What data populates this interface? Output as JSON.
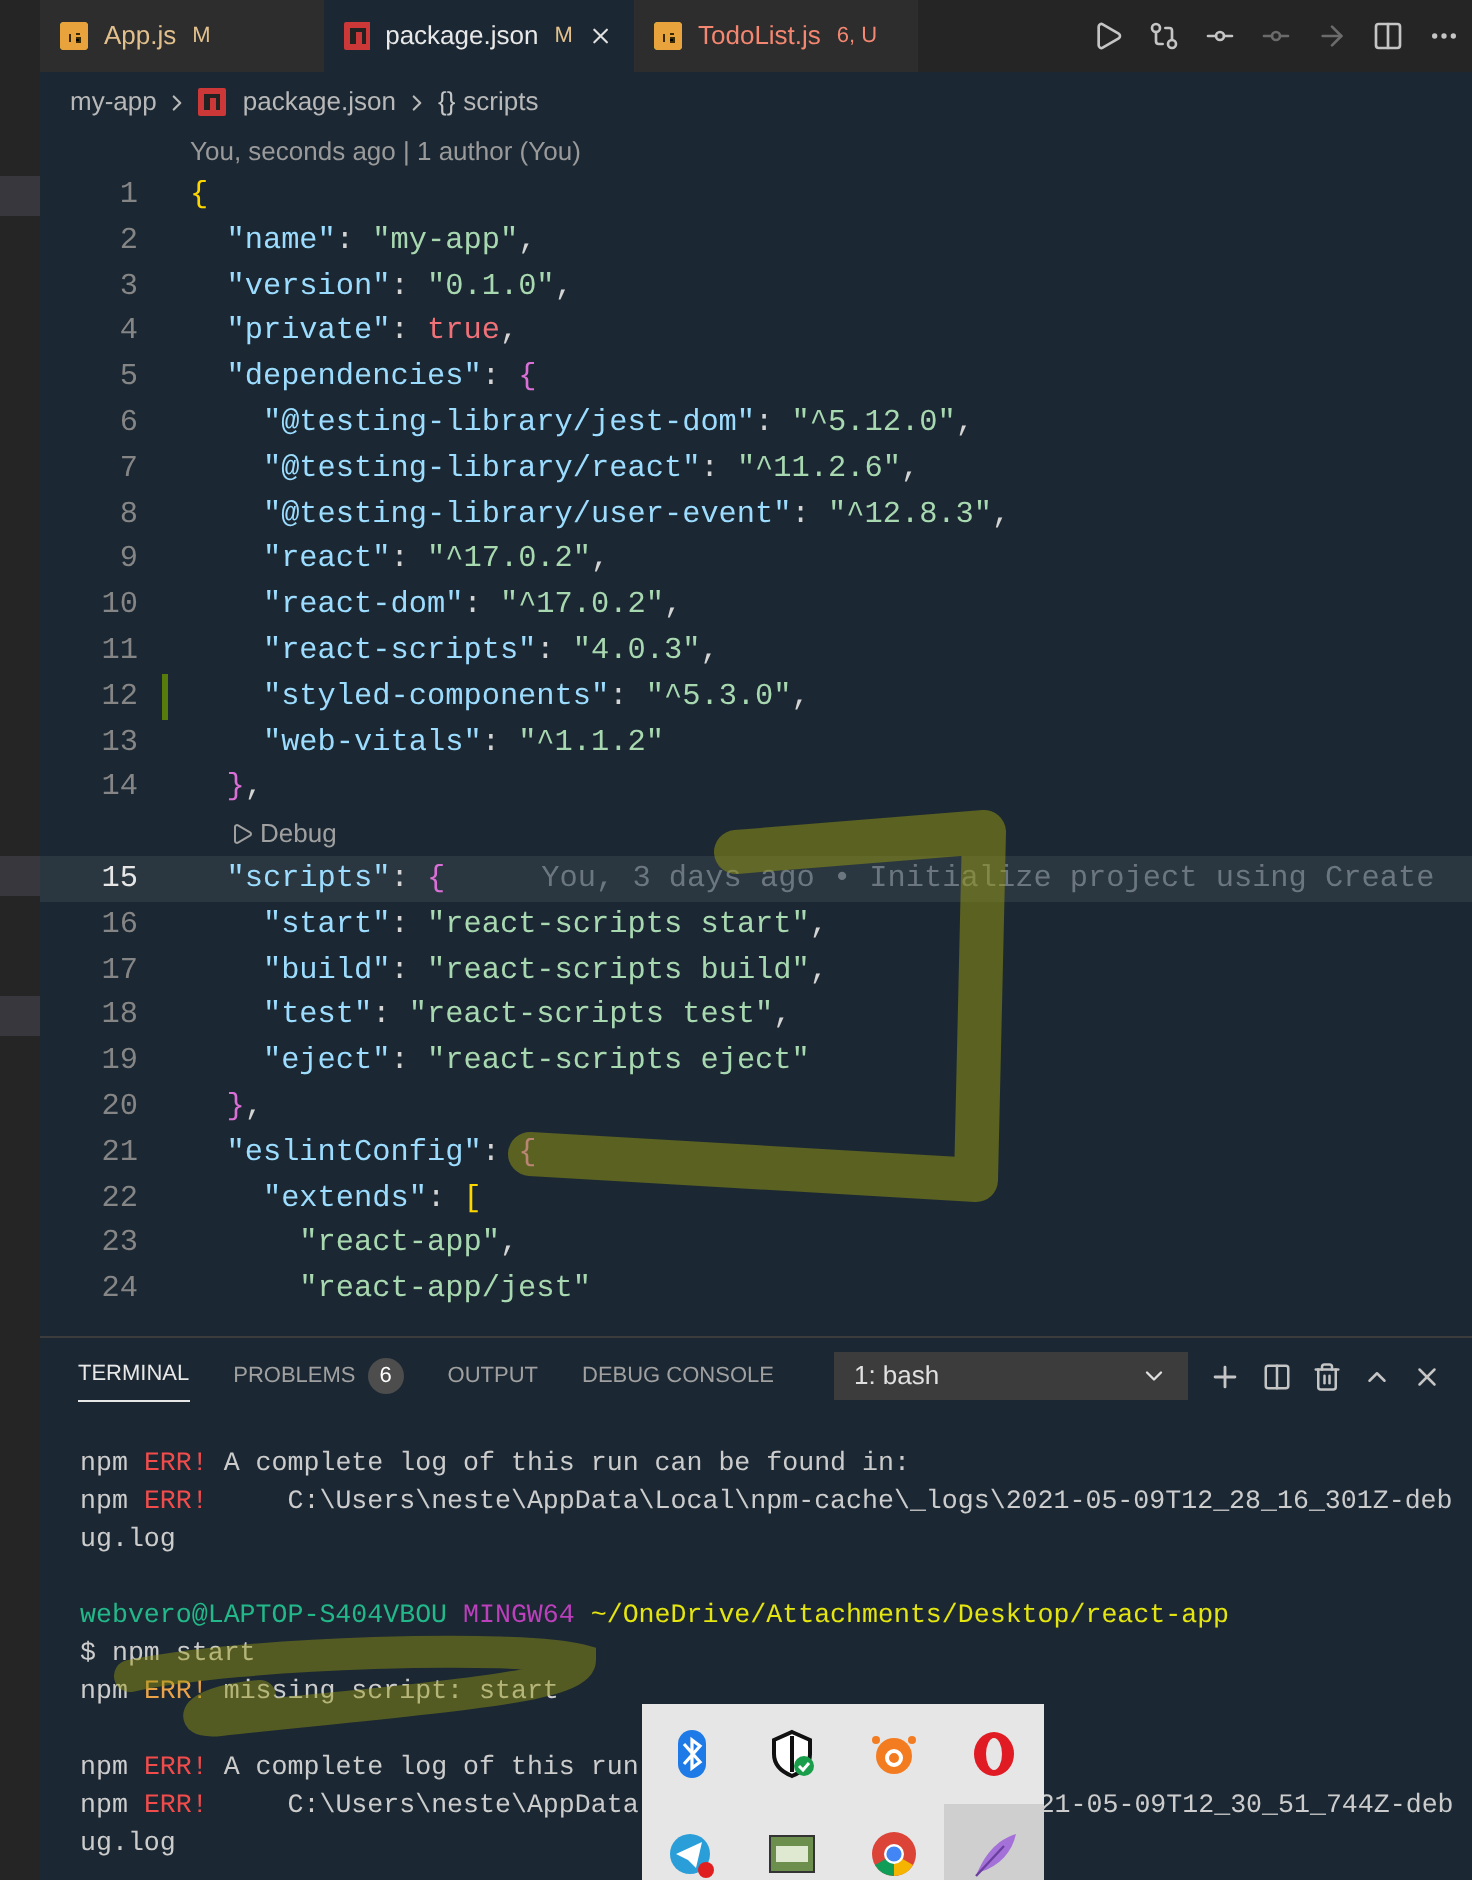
{
  "tabs": [
    {
      "label": "App.js",
      "status": "M",
      "selected": false,
      "kind": "js",
      "error": false
    },
    {
      "label": "package.json",
      "status": "M",
      "selected": true,
      "kind": "json",
      "error": false
    },
    {
      "label": "TodoList.js",
      "status": "6, U",
      "selected": false,
      "kind": "js",
      "error": true
    }
  ],
  "breadcrumbs": {
    "folder": "my-app",
    "file": "package.json",
    "symbol_icon": "{}",
    "symbol": "scripts"
  },
  "blame_header": "You, seconds ago | 1 author (You)",
  "code_lines": [
    {
      "number": "1",
      "tokens": [
        {
          "kind": "brace_outer",
          "text": "{"
        }
      ]
    },
    {
      "number": "2",
      "tokens": [
        {
          "kind": "key",
          "text": "  \"name\""
        },
        {
          "kind": "punct",
          "text": ": "
        },
        {
          "kind": "string",
          "text": "\"my-app\""
        },
        {
          "kind": "punct",
          "text": ","
        }
      ]
    },
    {
      "number": "3",
      "tokens": [
        {
          "kind": "key",
          "text": "  \"version\""
        },
        {
          "kind": "punct",
          "text": ": "
        },
        {
          "kind": "string",
          "text": "\"0.1.0\""
        },
        {
          "kind": "punct",
          "text": ","
        }
      ]
    },
    {
      "number": "4",
      "tokens": [
        {
          "kind": "key",
          "text": "  \"private\""
        },
        {
          "kind": "punct",
          "text": ": "
        },
        {
          "kind": "literal",
          "text": "true"
        },
        {
          "kind": "punct",
          "text": ","
        }
      ]
    },
    {
      "number": "5",
      "tokens": [
        {
          "kind": "key",
          "text": "  \"dependencies\""
        },
        {
          "kind": "punct",
          "text": ": "
        },
        {
          "kind": "brace_inner",
          "text": "{"
        }
      ]
    },
    {
      "number": "6",
      "tokens": [
        {
          "kind": "key",
          "text": "    \"@testing-library/jest-dom\""
        },
        {
          "kind": "punct",
          "text": ": "
        },
        {
          "kind": "string",
          "text": "\"^5.12.0\""
        },
        {
          "kind": "punct",
          "text": ","
        }
      ]
    },
    {
      "number": "7",
      "tokens": [
        {
          "kind": "key",
          "text": "    \"@testing-library/react\""
        },
        {
          "kind": "punct",
          "text": ": "
        },
        {
          "kind": "string",
          "text": "\"^11.2.6\""
        },
        {
          "kind": "punct",
          "text": ","
        }
      ]
    },
    {
      "number": "8",
      "tokens": [
        {
          "kind": "key",
          "text": "    \"@testing-library/user-event\""
        },
        {
          "kind": "punct",
          "text": ": "
        },
        {
          "kind": "string",
          "text": "\"^12.8.3\""
        },
        {
          "kind": "punct",
          "text": ","
        }
      ]
    },
    {
      "number": "9",
      "tokens": [
        {
          "kind": "key",
          "text": "    \"react\""
        },
        {
          "kind": "punct",
          "text": ": "
        },
        {
          "kind": "string",
          "text": "\"^17.0.2\""
        },
        {
          "kind": "punct",
          "text": ","
        }
      ]
    },
    {
      "number": "10",
      "tokens": [
        {
          "kind": "key",
          "text": "    \"react-dom\""
        },
        {
          "kind": "punct",
          "text": ": "
        },
        {
          "kind": "string",
          "text": "\"^17.0.2\""
        },
        {
          "kind": "punct",
          "text": ","
        }
      ]
    },
    {
      "number": "11",
      "tokens": [
        {
          "kind": "key",
          "text": "    \"react-scripts\""
        },
        {
          "kind": "punct",
          "text": ": "
        },
        {
          "kind": "string",
          "text": "\"4.0.3\""
        },
        {
          "kind": "punct",
          "text": ","
        }
      ]
    },
    {
      "number": "12",
      "modified": true,
      "tokens": [
        {
          "kind": "key",
          "text": "    \"styled-components\""
        },
        {
          "kind": "punct",
          "text": ": "
        },
        {
          "kind": "string",
          "text": "\"^5.3.0\""
        },
        {
          "kind": "punct",
          "text": ","
        }
      ]
    },
    {
      "number": "13",
      "tokens": [
        {
          "kind": "key",
          "text": "    \"web-vitals\""
        },
        {
          "kind": "punct",
          "text": ": "
        },
        {
          "kind": "string",
          "text": "\"^1.1.2\""
        }
      ]
    },
    {
      "number": "14",
      "code_lens": "Debug",
      "tokens": [
        {
          "kind": "brace_inner",
          "text": "  }"
        },
        {
          "kind": "punct",
          "text": ","
        }
      ]
    },
    {
      "number": "15",
      "current": true,
      "blame": "You, 3 days ago • Initialize project using Create",
      "tokens": [
        {
          "kind": "key",
          "text": "  \"scripts\""
        },
        {
          "kind": "punct",
          "text": ": "
        },
        {
          "kind": "brace_inner",
          "text": "{"
        }
      ]
    },
    {
      "number": "16",
      "tokens": [
        {
          "kind": "key",
          "text": "    \"start\""
        },
        {
          "kind": "punct",
          "text": ": "
        },
        {
          "kind": "string",
          "text": "\"react-scripts start\""
        },
        {
          "kind": "punct",
          "text": ","
        }
      ]
    },
    {
      "number": "17",
      "tokens": [
        {
          "kind": "key",
          "text": "    \"build\""
        },
        {
          "kind": "punct",
          "text": ": "
        },
        {
          "kind": "string",
          "text": "\"react-scripts build\""
        },
        {
          "kind": "punct",
          "text": ","
        }
      ]
    },
    {
      "number": "18",
      "tokens": [
        {
          "kind": "key",
          "text": "    \"test\""
        },
        {
          "kind": "punct",
          "text": ": "
        },
        {
          "kind": "string",
          "text": "\"react-scripts test\""
        },
        {
          "kind": "punct",
          "text": ","
        }
      ]
    },
    {
      "number": "19",
      "tokens": [
        {
          "kind": "key",
          "text": "    \"eject\""
        },
        {
          "kind": "punct",
          "text": ": "
        },
        {
          "kind": "string",
          "text": "\"react-scripts eject\""
        }
      ]
    },
    {
      "number": "20",
      "tokens": [
        {
          "kind": "brace_inner",
          "text": "  }"
        },
        {
          "kind": "punct",
          "text": ","
        }
      ]
    },
    {
      "number": "21",
      "tokens": [
        {
          "kind": "key",
          "text": "  \"eslintConfig\""
        },
        {
          "kind": "punct",
          "text": ": "
        },
        {
          "kind": "brace_inner",
          "text": "{"
        }
      ]
    },
    {
      "number": "22",
      "tokens": [
        {
          "kind": "key",
          "text": "    \"extends\""
        },
        {
          "kind": "punct",
          "text": ": "
        },
        {
          "kind": "brace_outer",
          "text": "["
        }
      ]
    },
    {
      "number": "23",
      "tokens": [
        {
          "kind": "string",
          "text": "      \"react-app\""
        },
        {
          "kind": "punct",
          "text": ","
        }
      ]
    },
    {
      "number": "24",
      "tokens": [
        {
          "kind": "string",
          "text": "      \"react-app/jest\""
        }
      ]
    }
  ],
  "panel_tabs": [
    {
      "label": "TERMINAL",
      "selected": true
    },
    {
      "label": "PROBLEMS",
      "badge": "6",
      "selected": false
    },
    {
      "label": "OUTPUT",
      "selected": false
    },
    {
      "label": "DEBUG CONSOLE",
      "selected": false
    }
  ],
  "terminal_select": "1: bash",
  "terminal_lines": [
    {
      "kind": "error",
      "prefix": "npm",
      "err": "ERR!",
      "text": " A complete log of this run can be found in:"
    },
    {
      "kind": "error",
      "prefix": "npm",
      "err": "ERR!",
      "text": "     C:\\Users\\neste\\AppData\\Local\\npm-cache\\_logs\\2021-05-09T12_28_16_301Z-deb"
    },
    {
      "kind": "plain",
      "text": "ug.log"
    },
    {
      "kind": "blank"
    },
    {
      "kind": "prompt",
      "user": "webvero@LAPTOP-S404VBOU",
      "shell": "MINGW64",
      "path": "~/OneDrive/Attachments/Desktop/react-app"
    },
    {
      "kind": "plain",
      "text": "$ npm start"
    },
    {
      "kind": "warn",
      "prefix": "npm",
      "err": "ERR!",
      "text": " missing script: start"
    },
    {
      "kind": "blank"
    },
    {
      "kind": "error",
      "prefix": "npm",
      "err": "ERR!",
      "text": " A complete log of this run"
    },
    {
      "kind": "error",
      "prefix": "npm",
      "err": "ERR!",
      "text": "     C:\\Users\\neste\\AppData",
      "tail": "21-05-09T12_30_51_744Z-deb"
    },
    {
      "kind": "plain",
      "text": "ug.log"
    }
  ],
  "tray_icons": [
    {
      "kind": "bluetooth",
      "selected": false
    },
    {
      "kind": "shield",
      "selected": false
    },
    {
      "kind": "antivirus",
      "selected": false
    },
    {
      "kind": "browser_o",
      "selected": false
    },
    {
      "kind": "paper_plane",
      "selected": false
    },
    {
      "kind": "app_tile",
      "selected": false
    },
    {
      "kind": "chrome",
      "selected": false
    },
    {
      "kind": "feather",
      "selected": true
    }
  ]
}
